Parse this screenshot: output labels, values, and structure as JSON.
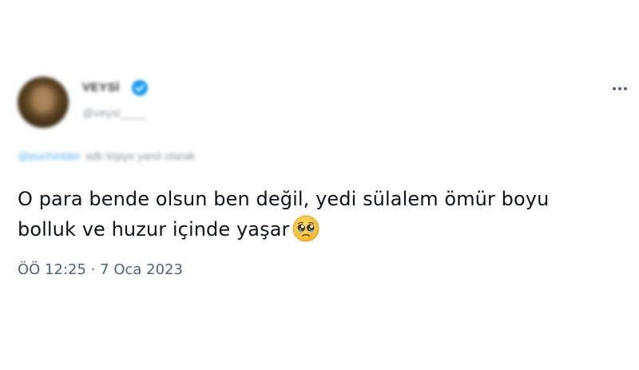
{
  "tweet": {
    "author": {
      "display_name": "VEYSİ",
      "handle": "@veysi____",
      "verified": true,
      "avatar_icon": "user-avatar"
    },
    "more_icon": "more-horizontal-icon",
    "reply": {
      "mention": "@puchinlder",
      "text": "adlı kişiye yanıt olarak"
    },
    "text_line_1": "O para bende olsun ben değil, yedi sülalem ömür boyu",
    "text_line_2": "bolluk ve huzur içinde yaşar",
    "emoji": "pleading-face-emoji",
    "time": "ÖÖ 12:25",
    "separator": "·",
    "date": "7 Oca 2023",
    "colors": {
      "text": "#0f1419",
      "secondary": "#536471",
      "accent": "#1d9bf0"
    }
  }
}
